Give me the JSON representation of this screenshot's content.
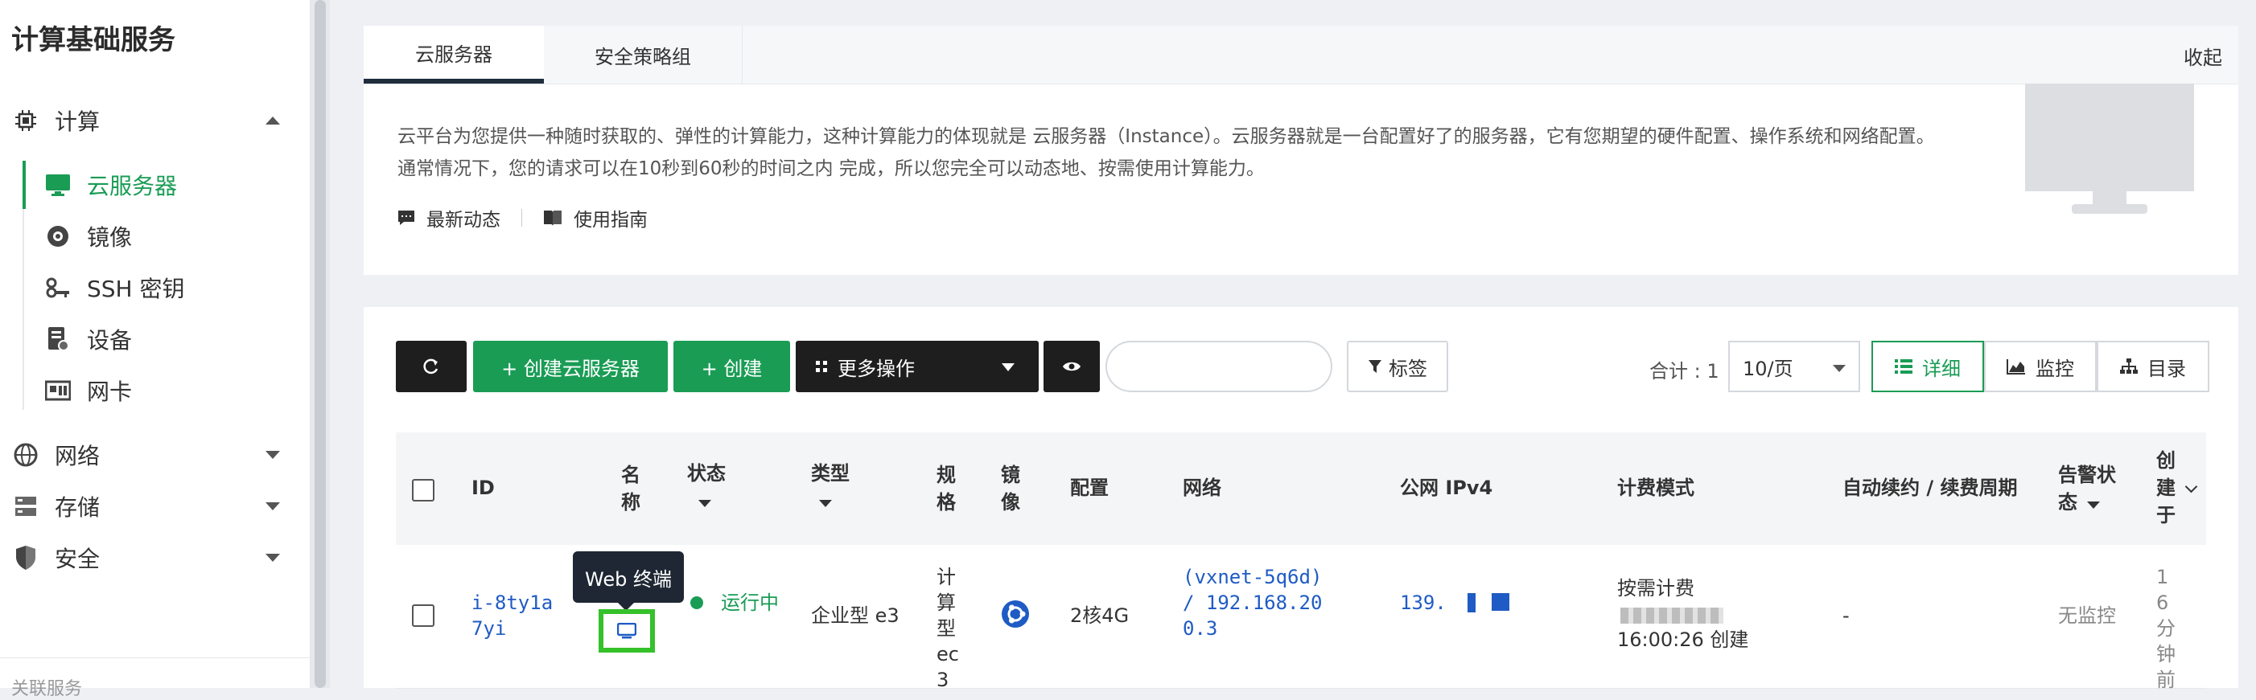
{
  "sidebar": {
    "title": "计算基础服务",
    "groups": [
      {
        "label": "计算",
        "icon": "cpu-icon",
        "expanded": true
      },
      {
        "label": "网络",
        "icon": "network-icon",
        "expanded": false
      },
      {
        "label": "存储",
        "icon": "storage-icon",
        "expanded": false
      },
      {
        "label": "安全",
        "icon": "shield-icon",
        "expanded": false
      }
    ],
    "compute_items": [
      {
        "label": "云服务器",
        "icon": "monitor-icon",
        "active": true
      },
      {
        "label": "镜像",
        "icon": "disc-icon"
      },
      {
        "label": "SSH 密钥",
        "icon": "key-icon"
      },
      {
        "label": "设备",
        "icon": "device-icon"
      },
      {
        "label": "网卡",
        "icon": "nic-icon"
      }
    ],
    "footer": "关联服务"
  },
  "intro": {
    "tabs": [
      "云服务器",
      "安全策略组"
    ],
    "collapse": "收起",
    "description": "云平台为您提供一种随时获取的、弹性的计算能力，这种计算能力的体现就是 云服务器（Instance）。云服务器就是一台配置好了的服务器，它有您期望的硬件配置、操作系统和网络配置。通常情况下，您的请求可以在10秒到60秒的时间之内 完成，所以您完全可以动态地、按需使用计算能力。",
    "links": [
      "最新动态",
      "使用指南"
    ]
  },
  "toolbar": {
    "create_instance": "+ 创建云服务器",
    "create": "+ 创建",
    "more_actions": "更多操作",
    "tags": "标签",
    "search_placeholder": "",
    "total": "合计 : 1",
    "page_size": "10/页",
    "views": [
      "详细",
      "监控",
      "目录"
    ]
  },
  "table": {
    "headers": {
      "id": "ID",
      "name": "名称",
      "status": "状态",
      "type": "类型",
      "spec": "规格",
      "image": "镜像",
      "config": "配置",
      "network": "网络",
      "public_ip": "公网 IPv4",
      "billing": "计费模式",
      "renew": "自动续约 / 续费周期",
      "alarm": "告警状态",
      "created": "创建于"
    },
    "rows": [
      {
        "id": "i-8ty1a7yi",
        "status": "运行中",
        "type": "企业型 e3",
        "spec": "计算型ec3",
        "config": "2核4G",
        "network": "(vxnet-5q6d) / 192.168.200.3",
        "public_ip": "139.",
        "billing": "按需计费",
        "billing_time": "16:00:26 创建",
        "renew": "-",
        "alarm": "无监控",
        "created": "16分钟前"
      }
    ],
    "tooltip": "Web 终端"
  },
  "colors": {
    "accent": "#1a9c55",
    "dark": "#1e1e1e",
    "link": "#1f5bc4"
  }
}
